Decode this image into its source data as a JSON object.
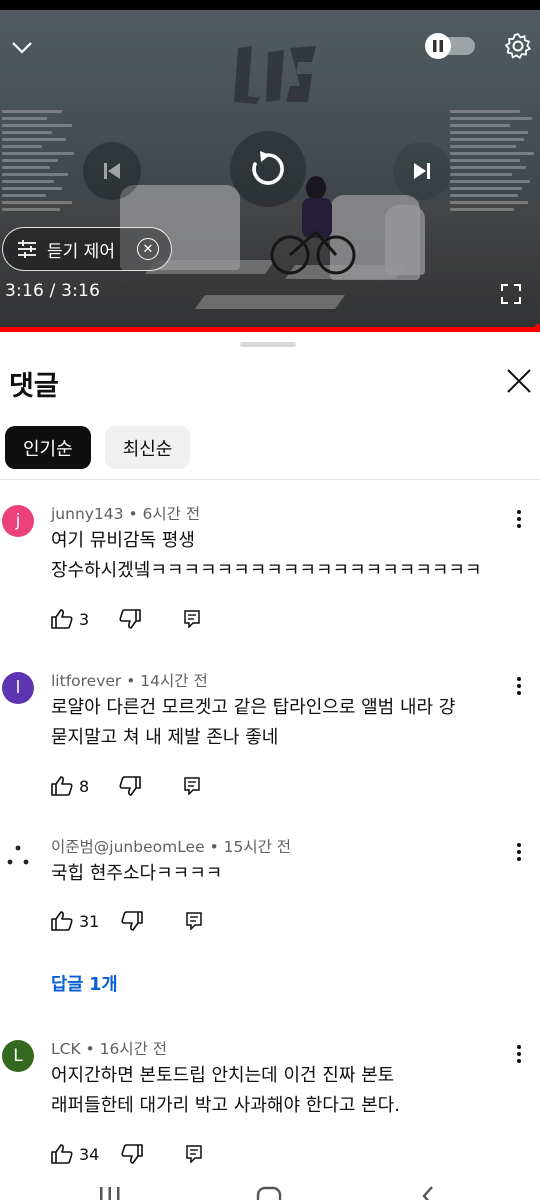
{
  "player": {
    "time_display": "3:16 / 3:16",
    "chip_label": "듣기 제어",
    "icons": [
      "chevron-down-icon",
      "pause-icon",
      "settings-gear-icon",
      "previous-icon",
      "replay-icon",
      "next-icon",
      "equalizer-icon",
      "close-circle-icon",
      "fullscreen-icon"
    ],
    "progress": 1.0,
    "progress_color": "#ff0000"
  },
  "comments_panel": {
    "title": "댓글",
    "sort_options": [
      {
        "label": "인기순",
        "active": true
      },
      {
        "label": "최신순",
        "active": false
      }
    ]
  },
  "comments": [
    {
      "author": "junny143",
      "time": "6시간 전",
      "avatar_letter": "j",
      "avatar_color": "#ec407a",
      "text_lines": [
        "여기 뮤비감독 평생",
        "장수하시겠넼ㅋㅋㅋㅋㅋㅋㅋㅋㅋㅋㅋㅋㅋㅋㅋㅋㅋㅋㅋㅋ"
      ],
      "likes": "3"
    },
    {
      "author": "litforever",
      "time": "14시간 전",
      "avatar_letter": "l",
      "avatar_color": "#5e35b1",
      "text_lines": [
        "로얄아 다른건 모르겟고 같은 탑라인으로 앨범 내라 걍",
        "묻지말고 쳐 내 제발 존나 좋네"
      ],
      "likes": "8"
    },
    {
      "author": "이준범@junbeomLee",
      "time": "15시간 전",
      "avatar_letter": "",
      "avatar_color": "#ffffff",
      "text_lines": [
        "국힙 현주소다ㅋㅋㅋㅋ"
      ],
      "likes": "31",
      "reply_link": "답글 1개"
    },
    {
      "author": "LCK",
      "time": "16시간 전",
      "avatar_letter": "L",
      "avatar_color": "#33691e",
      "text_lines": [
        "어지간하면 본토드립 안치는데 이건 진짜 본토",
        "래퍼들한테 대가리 박고 사과해야 한다고 본다."
      ],
      "likes": "34"
    }
  ],
  "meta_separator": " • "
}
